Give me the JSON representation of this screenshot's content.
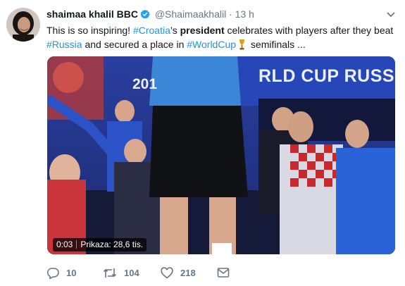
{
  "tweet": {
    "author_name": "shaimaa khalil BBC",
    "author_handle": "@Shaimaakhalil",
    "separator": "·",
    "time": "13 h",
    "text": {
      "t1": "This is so inspiring! ",
      "h1": "#Croatia",
      "t2": "’s ",
      "b1": "president",
      "t3": " celebrates with players after they beat",
      "h2": "#Russia",
      "t4": " and secured a place in ",
      "h3": "#WorldCup",
      "t5": " semifinals ..."
    }
  },
  "video": {
    "banner": "RLD CUP RUSSI",
    "banner_year": "201",
    "time": "0:03",
    "views": "Prikaza: 28,6 tis."
  },
  "actions": {
    "replies": "10",
    "retweets": "104",
    "likes": "218"
  },
  "colors": {
    "link": "#1b95e0",
    "secondary": "#657786",
    "verified": "#1da1f2"
  },
  "icons": [
    "verified-icon",
    "chevron-down-icon",
    "trophy-icon",
    "reply-icon",
    "retweet-icon",
    "like-icon",
    "dm-icon"
  ]
}
